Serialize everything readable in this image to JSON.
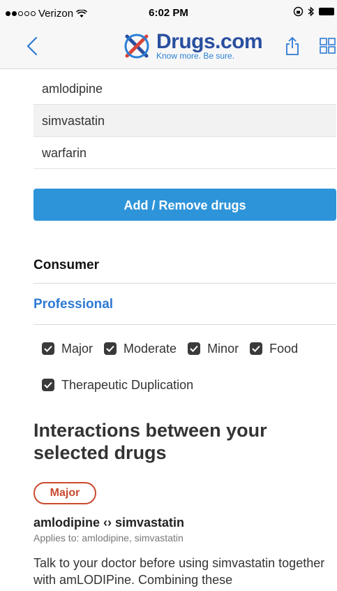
{
  "status_bar": {
    "carrier": "Verizon",
    "time": "6:02 PM"
  },
  "header": {
    "logo_name": "Drugs.com",
    "logo_tagline": "Know more. Be sure."
  },
  "drug_list": [
    "amlodipine",
    "simvastatin",
    "warfarin"
  ],
  "add_remove_button": "Add / Remove drugs",
  "modes": {
    "consumer": "Consumer",
    "professional": "Professional"
  },
  "filters": {
    "major": "Major",
    "moderate": "Moderate",
    "minor": "Minor",
    "food": "Food",
    "therapeutic": "Therapeutic Duplication"
  },
  "section_title": "Interactions between your selected drugs",
  "interaction": {
    "severity": "Major",
    "pair": "amlodipine ‹› simvastatin",
    "applies_to": "Applies to: amlodipine, simvastatin",
    "description": "Talk to your doctor before using simvastatin together with amLODIPine. Combining these"
  },
  "colors": {
    "primary": "#2e94d9",
    "professional_link": "#2e7ad4",
    "major_badge": "#c94a2f",
    "logo": "#2a4fa0"
  }
}
